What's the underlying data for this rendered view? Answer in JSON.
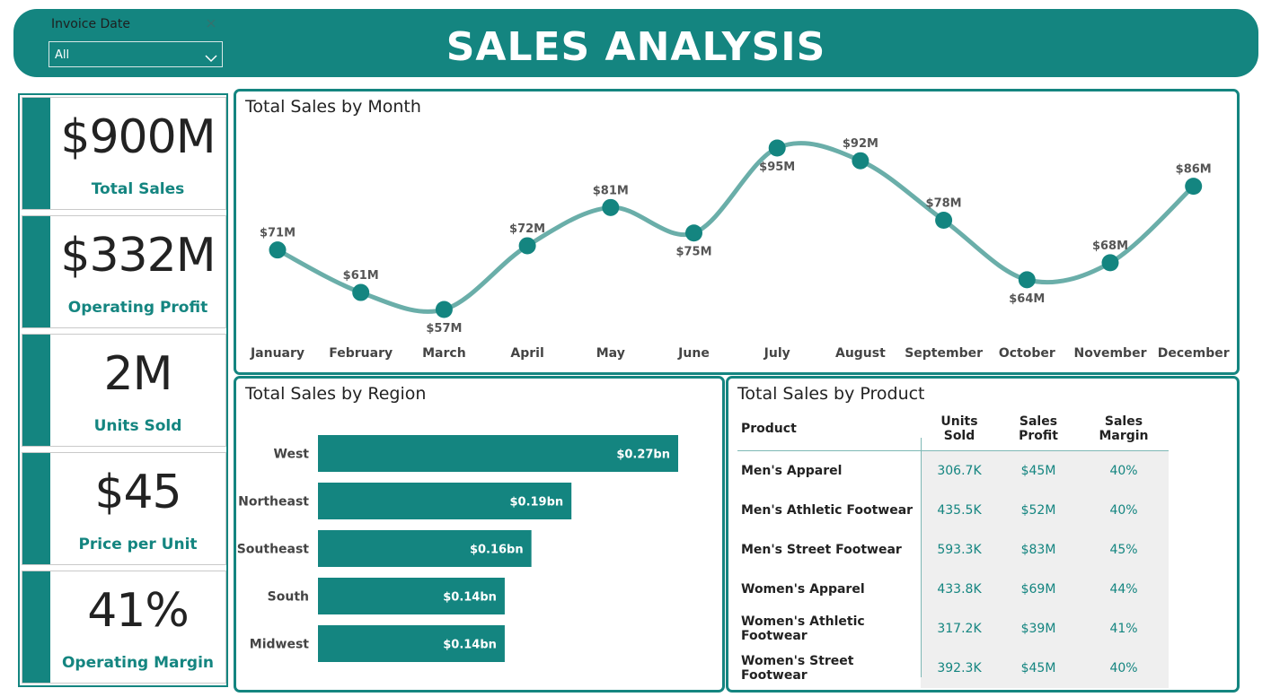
{
  "header": {
    "title": "SALES ANALYSIS",
    "filter_label": "Invoice Date",
    "filter_value": "All"
  },
  "kpis": [
    {
      "value": "$900M",
      "label": "Total Sales"
    },
    {
      "value": "$332M",
      "label": "Operating Profit"
    },
    {
      "value": "2M",
      "label": "Units Sold"
    },
    {
      "value": "$45",
      "label": "Price per Unit"
    },
    {
      "value": "41%",
      "label": "Operating Margin"
    }
  ],
  "colors": {
    "accent": "#148580",
    "line": "#6aaea9",
    "band": "#efefef"
  },
  "chart_data": [
    {
      "type": "line",
      "title": "Total Sales by Month",
      "categories": [
        "January",
        "February",
        "March",
        "April",
        "May",
        "June",
        "July",
        "August",
        "September",
        "October",
        "November",
        "December"
      ],
      "values": [
        71,
        61,
        57,
        72,
        81,
        75,
        95,
        92,
        78,
        64,
        68,
        86
      ],
      "labels": [
        "$71M",
        "$61M",
        "$57M",
        "$72M",
        "$81M",
        "$75M",
        "$95M",
        "$92M",
        "$78M",
        "$64M",
        "$68M",
        "$86M"
      ],
      "label_position": [
        "above",
        "above",
        "below",
        "above",
        "above",
        "below",
        "below",
        "above",
        "above",
        "below",
        "above",
        "above"
      ],
      "unit": "M"
    },
    {
      "type": "bar",
      "orientation": "horizontal",
      "title": "Total Sales by Region",
      "categories": [
        "West",
        "Northeast",
        "Southeast",
        "South",
        "Midwest"
      ],
      "values": [
        0.27,
        0.19,
        0.16,
        0.14,
        0.14
      ],
      "labels": [
        "$0.27bn",
        "$0.19bn",
        "$0.16bn",
        "$0.14bn",
        "$0.14bn"
      ],
      "unit": "bn"
    },
    {
      "type": "table",
      "title": "Total Sales by Product",
      "columns": [
        "Product",
        "Units Sold",
        "Sales Profit",
        "Sales Margin"
      ],
      "rows": [
        [
          "Men's Apparel",
          "306.7K",
          "$45M",
          "40%"
        ],
        [
          "Men's Athletic Footwear",
          "435.5K",
          "$52M",
          "40%"
        ],
        [
          "Men's Street Footwear",
          "593.3K",
          "$83M",
          "45%"
        ],
        [
          "Women's Apparel",
          "433.8K",
          "$69M",
          "44%"
        ],
        [
          "Women's Athletic Footwear",
          "317.2K",
          "$39M",
          "41%"
        ],
        [
          "Women's Street Footwear",
          "392.3K",
          "$45M",
          "40%"
        ]
      ]
    }
  ]
}
